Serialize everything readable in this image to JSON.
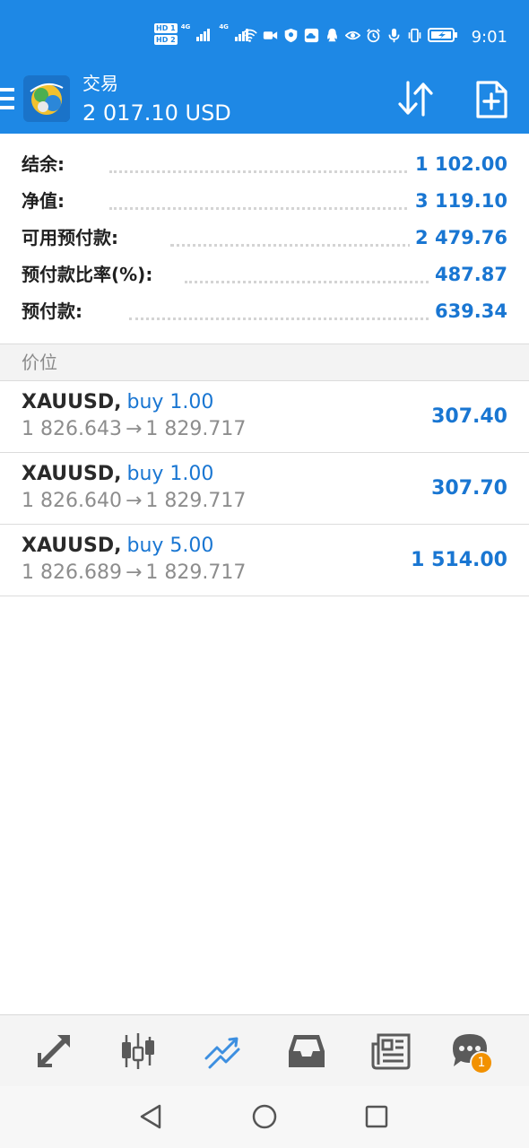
{
  "status_bar": {
    "time": "9:01",
    "hd1": "HD 1",
    "hd2": "HD 2",
    "net1": "4G",
    "net2": "4G",
    "icons": [
      "wifi-icon",
      "video-icon",
      "shield-icon",
      "cloud-app-icon",
      "qq-icon",
      "eye-icon",
      "alarm-icon",
      "mic-icon",
      "vibrate-icon",
      "battery-icon"
    ]
  },
  "app_bar": {
    "title": "交易",
    "balance_display": "2 017.10 USD",
    "icons": [
      "menu-icon",
      "metatrader-logo",
      "sort-icon",
      "new-order-icon"
    ]
  },
  "summary": [
    {
      "label": "结余:",
      "value": "1 102.00"
    },
    {
      "label": "净值:",
      "value": "3 119.10"
    },
    {
      "label": "可用预付款:",
      "value": "2 479.76"
    },
    {
      "label": "预付款比率(%):",
      "value": "487.87"
    },
    {
      "label": "预付款:",
      "value": "639.34"
    }
  ],
  "section_title": "价位",
  "positions": [
    {
      "symbol": "XAUUSD,",
      "side": "buy 1.00",
      "open": "1 826.643",
      "arrow": "→",
      "current": "1 829.717",
      "profit": "307.40"
    },
    {
      "symbol": "XAUUSD,",
      "side": "buy 1.00",
      "open": "1 826.640",
      "arrow": "→",
      "current": "1 829.717",
      "profit": "307.70"
    },
    {
      "symbol": "XAUUSD,",
      "side": "buy 5.00",
      "open": "1 826.689",
      "arrow": "→",
      "current": "1 829.717",
      "profit": "1 514.00"
    }
  ],
  "tabs": [
    {
      "name": "quotes",
      "icon": "quotes-arrows-icon",
      "active": false
    },
    {
      "name": "chart",
      "icon": "candlestick-chart-icon",
      "active": false
    },
    {
      "name": "trade",
      "icon": "trade-trend-icon",
      "active": true
    },
    {
      "name": "history",
      "icon": "inbox-history-icon",
      "active": false
    },
    {
      "name": "news",
      "icon": "news-icon",
      "active": false
    },
    {
      "name": "messages",
      "icon": "chat-icon",
      "active": false,
      "badge": "1"
    }
  ],
  "colors": {
    "brand": "#1e88e5",
    "value_blue": "#1976d2",
    "tab_active": "#3d8fe0",
    "tab_inactive": "#5a5a5a",
    "badge": "#f29100"
  }
}
